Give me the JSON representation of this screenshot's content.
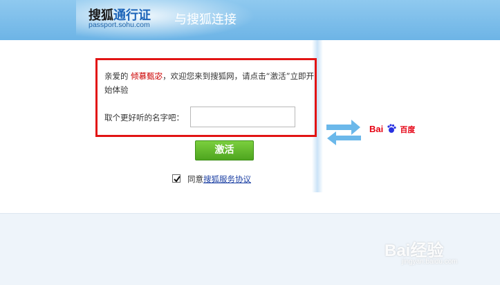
{
  "header": {
    "logo_part1": "搜狐",
    "logo_part2": "通行证",
    "logo_url": "passport.sohu.com",
    "title": "与搜狐连接"
  },
  "welcome": {
    "prefix": "亲爱的 ",
    "username": "倾慕甄宓",
    "suffix": "，欢迎您来到搜狐网，请点击“激活”立即开始体验"
  },
  "form": {
    "nickname_label": "取个更好听的名字吧：",
    "nickname_value": "",
    "nickname_placeholder": "",
    "activate_label": "激活"
  },
  "agreement": {
    "checked": true,
    "prefix": "同意",
    "link_label": "搜狐服务协议"
  },
  "partner": {
    "logo_text_left": "Bai",
    "logo_text_right": "百度"
  },
  "watermark": {
    "main": "Bai经验",
    "sub": "jingyan.baidu.com"
  },
  "colors": {
    "header_blue": "#7dbfeb",
    "highlight_red": "#e21414",
    "activate_green": "#5cb82b",
    "link_blue": "#1b3fa3",
    "username_red": "#cc0000"
  },
  "icons": {
    "swap": "bidirectional-arrows-icon",
    "checkbox": "checkmark-icon",
    "partner": "baidu-paw-icon"
  }
}
